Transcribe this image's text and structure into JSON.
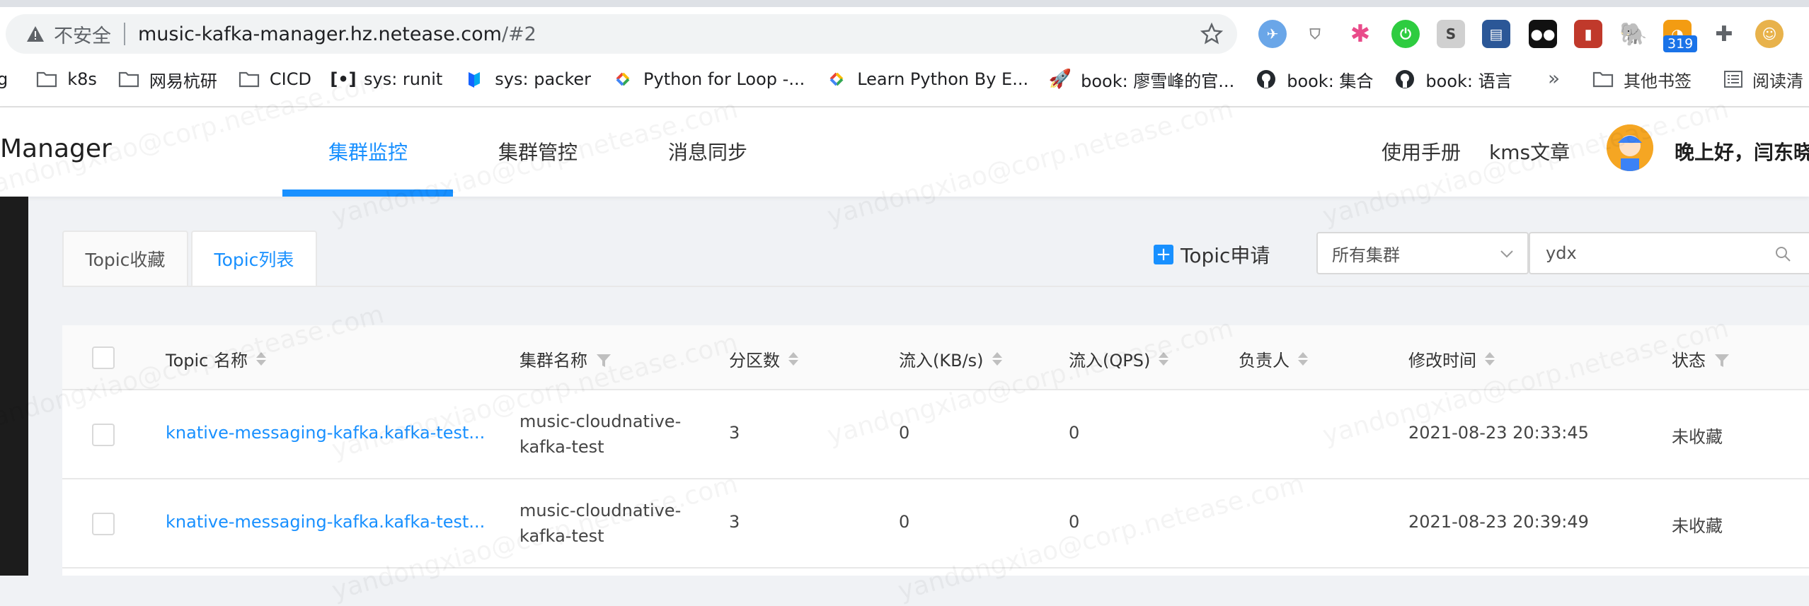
{
  "browser": {
    "insecure_label": "不安全",
    "url_host": "music-kafka-manager.hz.netease.com",
    "url_path": "/#2",
    "ext_badge": "319",
    "bookmarks": [
      {
        "icon": "folder-icon",
        "label": "k8s"
      },
      {
        "icon": "folder-icon",
        "label": "网易杭研"
      },
      {
        "icon": "folder-icon",
        "label": "CICD"
      },
      {
        "icon": "runit-icon",
        "label": "sys: runit"
      },
      {
        "icon": "packer-icon",
        "label": "sys: packer"
      },
      {
        "icon": "google-icon",
        "label": "Python for Loop -..."
      },
      {
        "icon": "google-icon",
        "label": "Learn Python By E..."
      },
      {
        "icon": "rocket-icon",
        "label": "book: 廖雪峰的官..."
      },
      {
        "icon": "github-icon",
        "label": "book: 集合"
      },
      {
        "icon": "github-icon",
        "label": "book: 语言"
      }
    ],
    "more": "»",
    "other_bookmarks": "其他书签",
    "reading_list": "阅读清"
  },
  "header": {
    "brand": "Manager",
    "nav": [
      "集群监控",
      "集群管控",
      "消息同步"
    ],
    "manual": "使用手册",
    "kms": "kms文章",
    "greeting": "晚上好，闫东晓"
  },
  "toolbar": {
    "tabs": [
      "Topic收藏",
      "Topic列表"
    ],
    "apply_label": "Topic申请",
    "cluster_select": "所有集群",
    "search_value": "ydx"
  },
  "table": {
    "headers": [
      "Topic 名称",
      "集群名称",
      "分区数",
      "流入(KB/s)",
      "流入(QPS)",
      "负责人",
      "修改时间",
      "状态"
    ],
    "rows": [
      {
        "topic": "knative-messaging-kafka.kafka-test...",
        "cluster_line1": "music-cloudnative-",
        "cluster_line2": "kafka-test",
        "partitions": "3",
        "kbs": "0",
        "qps": "0",
        "owner": "",
        "modified": "2021-08-23 20:33:45",
        "status": "未收藏"
      },
      {
        "topic": "knative-messaging-kafka.kafka-test...",
        "cluster_line1": "music-cloudnative-",
        "cluster_line2": "kafka-test",
        "partitions": "3",
        "kbs": "0",
        "qps": "0",
        "owner": "",
        "modified": "2021-08-23 20:39:49",
        "status": "未收藏"
      }
    ]
  },
  "watermark": "yandongxiao@corp.netease.com",
  "colors": {
    "accent": "#1890ff",
    "sidebar": "#1c1c1c"
  }
}
